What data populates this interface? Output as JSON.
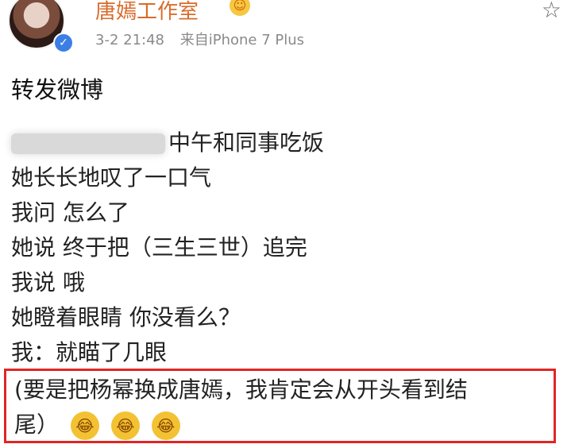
{
  "header": {
    "username": "唐嫣工作室",
    "timestamp": "3-2 21:48",
    "source": "来自iPhone 7 Plus",
    "star_icon": "star-icon"
  },
  "post": {
    "forward_title": "转发微博",
    "lines": [
      "中午和同事吃饭",
      "她长长地叹了一口气",
      "我问 怎么了",
      "她说 终于把（三生三世）追完",
      "我说 哦",
      "她瞪着眼睛 你没看么？",
      "我：就瞄了几眼"
    ],
    "highlight": {
      "line1": "(要是把杨幂换成唐嫣，我肯定会从开头看到结",
      "line2": "尾）"
    }
  },
  "colors": {
    "username": "#d96b2b",
    "highlight_border": "#e02525"
  }
}
